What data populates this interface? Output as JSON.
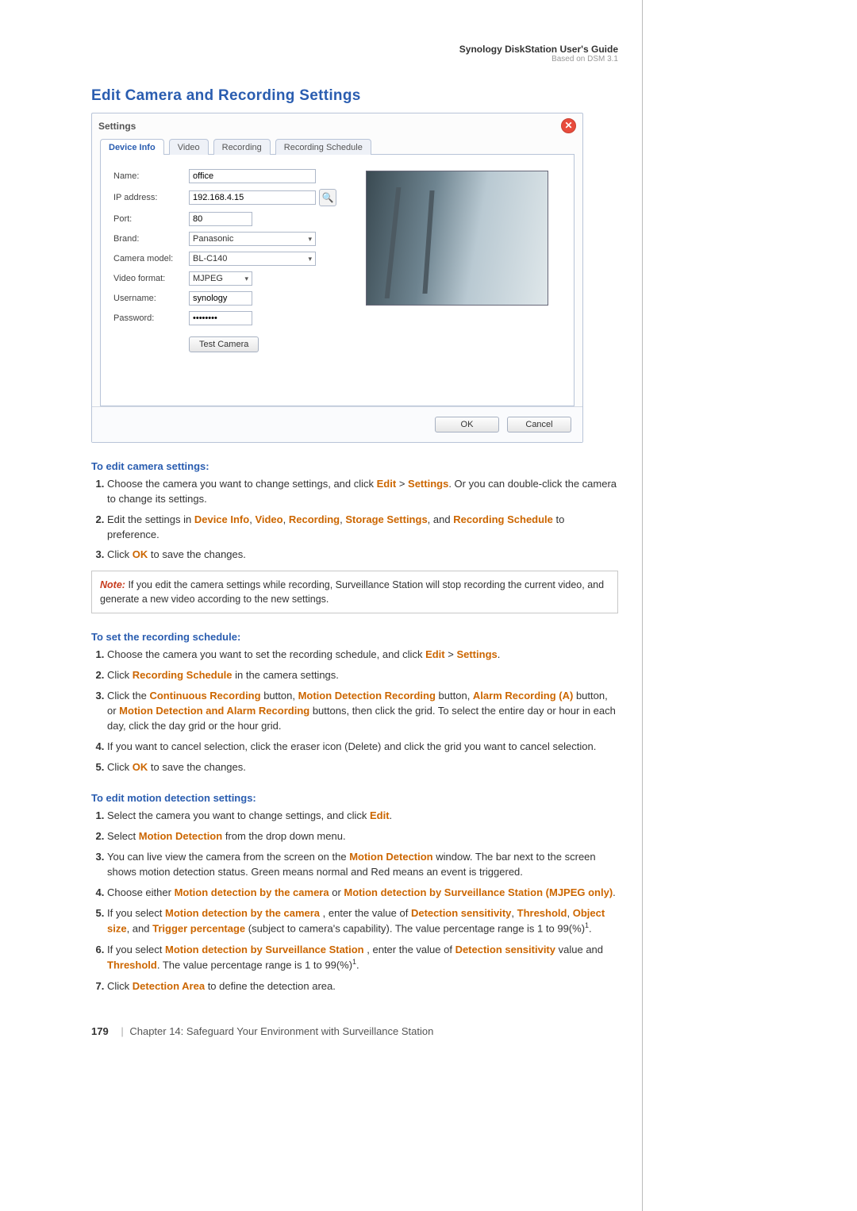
{
  "header": {
    "title": "Synology DiskStation User's Guide",
    "subtitle": "Based on DSM 3.1"
  },
  "pageHeading": "Edit Camera and Recording Settings",
  "dialog": {
    "title": "Settings",
    "tabs": [
      "Device Info",
      "Video",
      "Recording",
      "Recording Schedule"
    ],
    "fields": {
      "name": {
        "label": "Name:",
        "value": "office"
      },
      "ip": {
        "label": "IP address:",
        "value": "192.168.4.15"
      },
      "port": {
        "label": "Port:",
        "value": "80"
      },
      "brand": {
        "label": "Brand:",
        "value": "Panasonic"
      },
      "model": {
        "label": "Camera model:",
        "value": "BL-C140"
      },
      "format": {
        "label": "Video format:",
        "value": "MJPEG"
      },
      "username": {
        "label": "Username:",
        "value": "synology"
      },
      "password": {
        "label": "Password:",
        "value": "••••••••"
      }
    },
    "testBtn": "Test Camera",
    "okBtn": "OK",
    "cancelBtn": "Cancel"
  },
  "sections": {
    "editCam": {
      "title": "To edit camera settings:",
      "step1a": "Choose the camera you want to change settings, and click ",
      "step1b": ". Or you can double-click the camera to change its settings.",
      "step2a": "Edit the settings in ",
      "step2b": " to preference.",
      "step3a": "Click ",
      "step3b": " to save the changes."
    },
    "note": "If you edit the camera settings while recording, Surveillance Station will stop recording the current video, and generate a new video according to the new settings.",
    "schedule": {
      "title": "To set the recording schedule:",
      "step1": "Choose the camera you want to set the recording schedule, and click ",
      "step2a": "Click ",
      "step2b": " in the camera settings.",
      "step3a": "Click the ",
      "step3b": " button, ",
      "step3c": " button, ",
      "step3d": " button, or ",
      "step3e": " buttons, then click the grid. To select the entire day or hour in each day, click the day grid or the hour grid.",
      "step4": "If you want to cancel selection, click the eraser icon (Delete) and click the grid you want to cancel selection.",
      "step5a": "Click ",
      "step5b": " to save the changes."
    },
    "motion": {
      "title": "To edit motion detection settings:",
      "step1a": "Select the camera you want to change settings, and click ",
      "step1b": ".",
      "step2a": "Select ",
      "step2b": " from the drop down menu.",
      "step3a": "You can live view the camera from the screen on the ",
      "step3b": " window. The bar next to the screen shows motion detection status. Green means normal and Red means an event is triggered.",
      "step4a": "Choose either ",
      "step4b": " or ",
      "step4c": ".",
      "step5a": "If you select ",
      "step5b": ", enter the value of ",
      "step5c": " (subject to camera's capability). The value percentage range is 1 to 99(%)",
      "step6a": "If you select ",
      "step6b": ", enter the value of ",
      "step6c": " value and ",
      "step6d": ". The value percentage range is 1 to 99(%)",
      "step7a": "Click ",
      "step7b": " to define the detection area."
    }
  },
  "kw": {
    "edit": "Edit",
    "settings": "Settings",
    "deviceInfo": "Device Info",
    "video": "Video",
    "recording": "Recording",
    "storage": "Storage Settings",
    "recSchedule": "Recording Schedule",
    "ok": "OK",
    "cont": "Continuous Recording",
    "mdr": "Motion Detection Recording",
    "alarmA": "Alarm Recording (A)",
    "mdAlarm": "Motion Detection and Alarm Recording",
    "md": "Motion Detection",
    "mdCam": "Motion detection by the camera",
    "mdSS": "Motion detection by Surveillance Station (MJPEG only)",
    "mdSS2": "Motion detection by Surveillance Station",
    "detSens": "Detection sensitivity",
    "threshold": "Threshold",
    "objSize": "Object size",
    "trigPct": "Trigger percentage",
    "detArea": "Detection Area",
    "noteLabel": "Note:"
  },
  "footer": {
    "page": "179",
    "chapter": "Chapter 14: Safeguard Your Environment with Surveillance Station"
  }
}
